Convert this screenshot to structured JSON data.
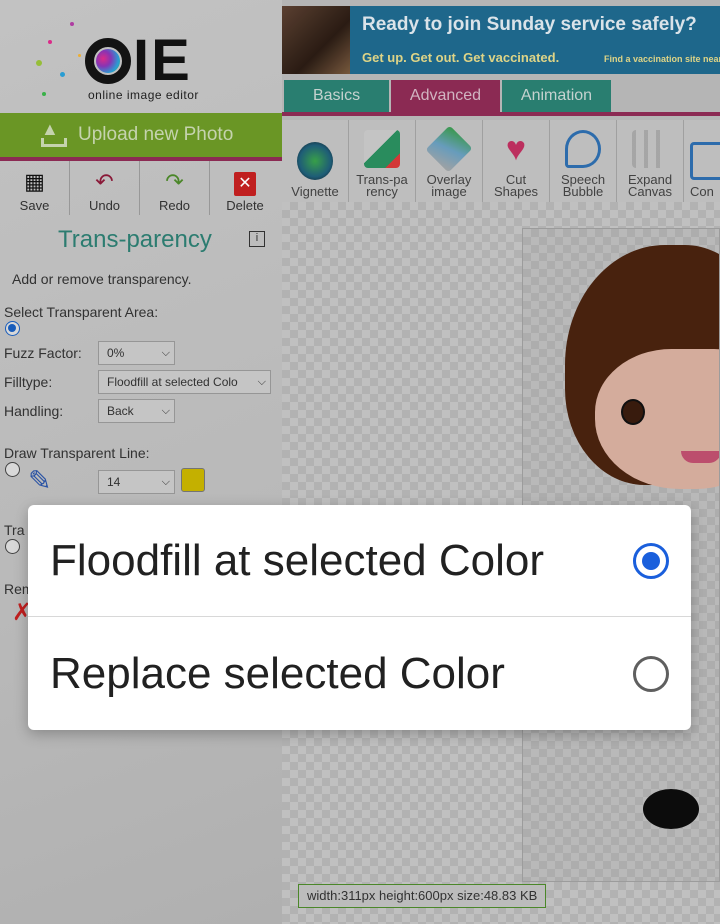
{
  "app": {
    "logo_text": "IE",
    "logo_subtitle": "online image editor",
    "upload_label": "Upload new Photo"
  },
  "toolbar": {
    "save_label": "Save",
    "undo_label": "Undo",
    "redo_label": "Redo",
    "delete_label": "Delete"
  },
  "ad": {
    "headline": "Ready to join Sunday service safely?",
    "subline": "Get up. Get out. Get vaccinated.",
    "link": "Find a vaccination site near"
  },
  "tabs": [
    {
      "label": "Basics",
      "active": false
    },
    {
      "label": "Advanced",
      "active": true
    },
    {
      "label": "Animation",
      "active": false
    }
  ],
  "effects": [
    {
      "label": "Vignette"
    },
    {
      "label": "Trans-parency"
    },
    {
      "label": "Overlay image"
    },
    {
      "label": "Cut Shapes"
    },
    {
      "label": "Speech Bubble"
    },
    {
      "label": "Expand Canvas"
    },
    {
      "label": "Con"
    }
  ],
  "panel": {
    "title": "Trans-parency",
    "info": "i",
    "description": "Add or remove transparency.",
    "select_area_label": "Select Transparent Area:",
    "fuzz_label": "Fuzz Factor:",
    "fuzz_value": "0%",
    "filltype_label": "Filltype:",
    "filltype_value": "Floodfill at selected Colo",
    "handling_label": "Handling:",
    "handling_value": "Back",
    "draw_line_label": "Draw Transparent Line:",
    "line_size_value": "14",
    "color_swatch": "#c8b400",
    "partial_label_1": "Tra",
    "partial_label_2": "Rem"
  },
  "canvas": {
    "size_info": "width:311px  height:600px  size:48.83 KB"
  },
  "dialog": {
    "options": [
      {
        "label": "Floodfill at selected Color",
        "selected": true
      },
      {
        "label": "Replace selected Color",
        "selected": false
      }
    ]
  },
  "colors": {
    "accent_green": "#6d9a26",
    "accent_maroon": "#8e2b55",
    "tab_teal": "#2a8173",
    "radio_blue": "#1a5fdc"
  }
}
